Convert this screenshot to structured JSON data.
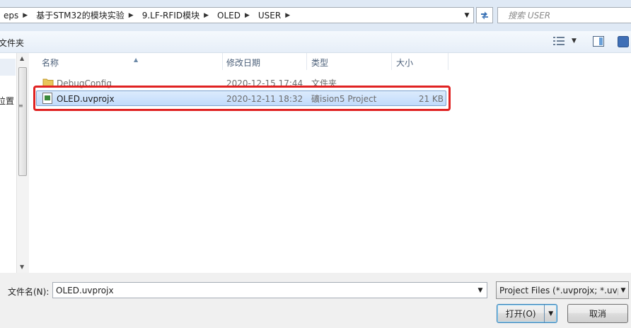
{
  "address": {
    "crumbs": [
      "eps",
      "基于STM32的模块实验",
      "9.LF-RFID模块",
      "OLED",
      "USER"
    ],
    "search_placeholder": "搜索 USER"
  },
  "toolbar": {
    "organize_label": "文件夹"
  },
  "nav": {
    "partial_label": "位置"
  },
  "columns": {
    "name": "名称",
    "date": "修改日期",
    "type": "类型",
    "size": "大小"
  },
  "files": [
    {
      "name": "DebugConfig",
      "date": "2020-12-15 17:44",
      "type": "文件夹",
      "size": ""
    },
    {
      "name": "OLED.uvprojx",
      "date": "2020-12-11 18:32",
      "type": "礦ision5 Project",
      "size": "21 KB"
    }
  ],
  "bottom": {
    "filename_label": "文件名(N):",
    "filename_value": "OLED.uvprojx",
    "filter_label": "Project Files (*.uvprojx; *.uvp",
    "open_label": "打开(O)",
    "cancel_label": "取消"
  },
  "colors": {
    "highlight": "#e02222",
    "selection": "#c1dbfc"
  },
  "icons": [
    "chevron-right-icon",
    "refresh-icon",
    "search-icon",
    "view-icon",
    "preview-pane-icon",
    "help-icon",
    "folder-icon",
    "project-file-icon"
  ]
}
